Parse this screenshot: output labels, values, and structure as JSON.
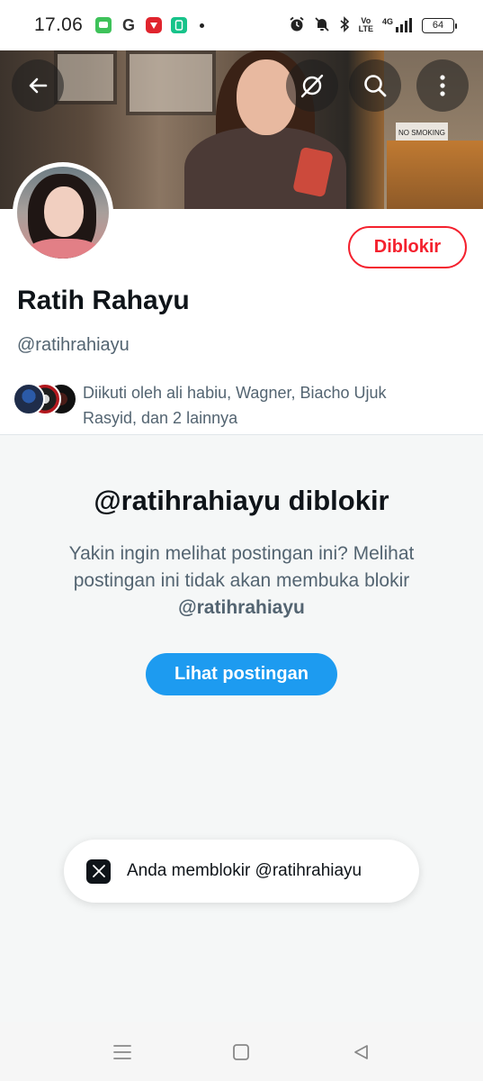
{
  "status_bar": {
    "time": "17.06",
    "g_icon": "G",
    "battery": "64",
    "network": "4G",
    "volte_top": "Vo",
    "volte_bottom": "LTE"
  },
  "banner": {
    "sign_text": "NO SMOKING"
  },
  "header_buttons": [
    "back-arrow-icon",
    "grok-icon",
    "search-icon",
    "more-vertical-icon"
  ],
  "profile": {
    "name": "Ratih Rahayu",
    "handle": "@ratihrahiayu",
    "blocked_button": "Diblokir",
    "followed_by": "Diikuti oleh ali habiu, Wagner, Biacho Ujuk Rasyid, dan 2 lainnya"
  },
  "blocked_notice": {
    "title": "@ratihrahiayu diblokir",
    "description": "Yakin ingin melihat postingan ini? Melihat postingan ini tidak akan membuka blokir",
    "description_handle": "@ratihrahiayu",
    "button": "Lihat postingan"
  },
  "toast": {
    "text": "Anda memblokir @ratihrahiayu"
  },
  "nav": [
    "menu-icon",
    "home-square-icon",
    "back-triangle-icon"
  ],
  "colors": {
    "accent": "#1d9bf0",
    "blocked_red": "#f4212e",
    "secondary_text": "#536471"
  }
}
